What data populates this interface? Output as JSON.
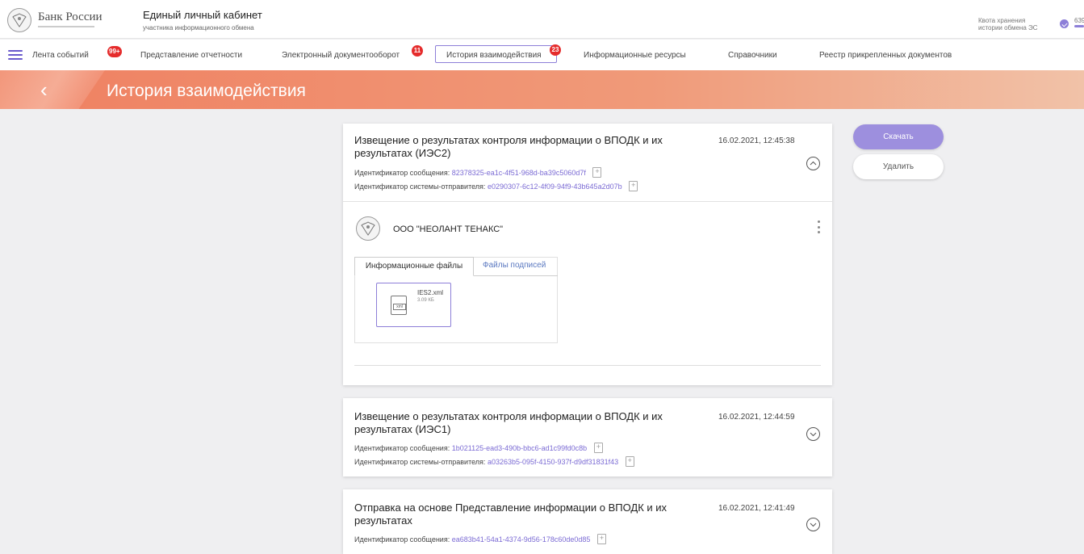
{
  "header": {
    "brand": "Банк России",
    "portal_title": "Единый личный кабинет",
    "portal_subtitle": "участника информационного обмена",
    "quota_label": "Квота хранения истории обмена ЭС",
    "quota_value": "639",
    "quota_fill": 1.0
  },
  "nav": {
    "items": [
      {
        "label": "Лента событий",
        "badge": "99+"
      },
      {
        "label": "Представление отчетности",
        "badge": ""
      },
      {
        "label": "Электронный документооборот",
        "badge": "11"
      },
      {
        "label": "История взаимодействия",
        "badge": "23"
      },
      {
        "label": "Информационные ресурсы",
        "badge": ""
      },
      {
        "label": "Справочники",
        "badge": ""
      },
      {
        "label": "Реестр прикрепленных документов",
        "badge": ""
      }
    ],
    "active": "История взаимодействия"
  },
  "page": {
    "title": "История взаимодействия",
    "back_glyph": "‹"
  },
  "labels": {
    "message_id": "Идентификатор сообщения:",
    "sender_id": "Идентификатор системы-отправителя:"
  },
  "cards": [
    {
      "title": "Извещение о результатах контроля информации о ВПОДК и их результатах (ИЭС2)",
      "date": "16.02.2021, 12:45:38",
      "message_id": "82378325-ea1c-4f51-968d-ba39c5060d7f",
      "sender_id": "e0290307-6c12-4f09-94f9-43b645a2d07b",
      "expanded": true
    },
    {
      "title": "Извещение о результатах контроля информации о ВПОДК и их результатах (ИЭС1)",
      "date": "16.02.2021, 12:44:59",
      "message_id": "1b021125-ead3-490b-bbc6-ad1c99fd0c8b",
      "sender_id": "a03263b5-095f-4150-937f-d9df31831f43",
      "expanded": false
    },
    {
      "title": "Отправка на основе Представление информации о ВПОДК и их результатах",
      "date": "16.02.2021, 12:41:49",
      "message_id": "ea683b41-54a1-4374-9d56-178c60de0d85",
      "expanded": false
    }
  ],
  "detail": {
    "organization": "ООО \"НЕОЛАНТ ТЕНАКС\"",
    "tabs": [
      "Информационные файлы",
      "Файлы подписей"
    ],
    "file": {
      "name": "IES2.xml",
      "size": "3.09 КБ",
      "type": "xml"
    }
  },
  "actions": {
    "download": "Скачать",
    "delete": "Удалить"
  },
  "colors": {
    "accent": "#8d7fd8",
    "badge": "#e52c2c",
    "band_start": "#ef8061",
    "link": "#7b6bd4"
  }
}
